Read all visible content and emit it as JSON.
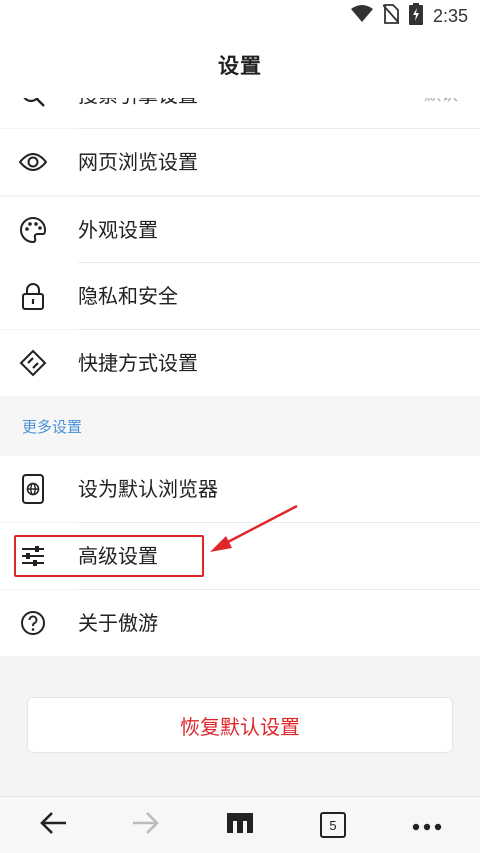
{
  "status_bar": {
    "time": "2:35",
    "icons": [
      "wifi-icon",
      "no-sim-icon",
      "battery-charging-icon"
    ]
  },
  "header": {
    "title": "设置"
  },
  "settings_items": [
    {
      "label": "搜索引擎设置",
      "value": "默认",
      "icon": "search-icon"
    },
    {
      "label": "网页浏览设置",
      "icon": "eye-icon"
    },
    {
      "label": "外观设置",
      "icon": "palette-icon"
    },
    {
      "label": "隐私和安全",
      "icon": "lock-icon"
    },
    {
      "label": "快捷方式设置",
      "icon": "shortcut-icon"
    }
  ],
  "more_section": {
    "title": "更多设置",
    "items": [
      {
        "label": "设为默认浏览器",
        "icon": "default-browser-icon"
      },
      {
        "label": "高级设置",
        "icon": "sliders-icon"
      },
      {
        "label": "关于傲游",
        "icon": "help-icon"
      }
    ]
  },
  "restore_button": {
    "label": "恢复默认设置"
  },
  "bottom_nav": {
    "tab_count": "5",
    "icons": [
      "back-arrow-icon",
      "forward-arrow-icon",
      "maxthon-logo-icon",
      "tabs-icon",
      "more-icon"
    ]
  },
  "colors": {
    "accent_red": "#e0262b",
    "section_blue": "#4a90d9"
  }
}
